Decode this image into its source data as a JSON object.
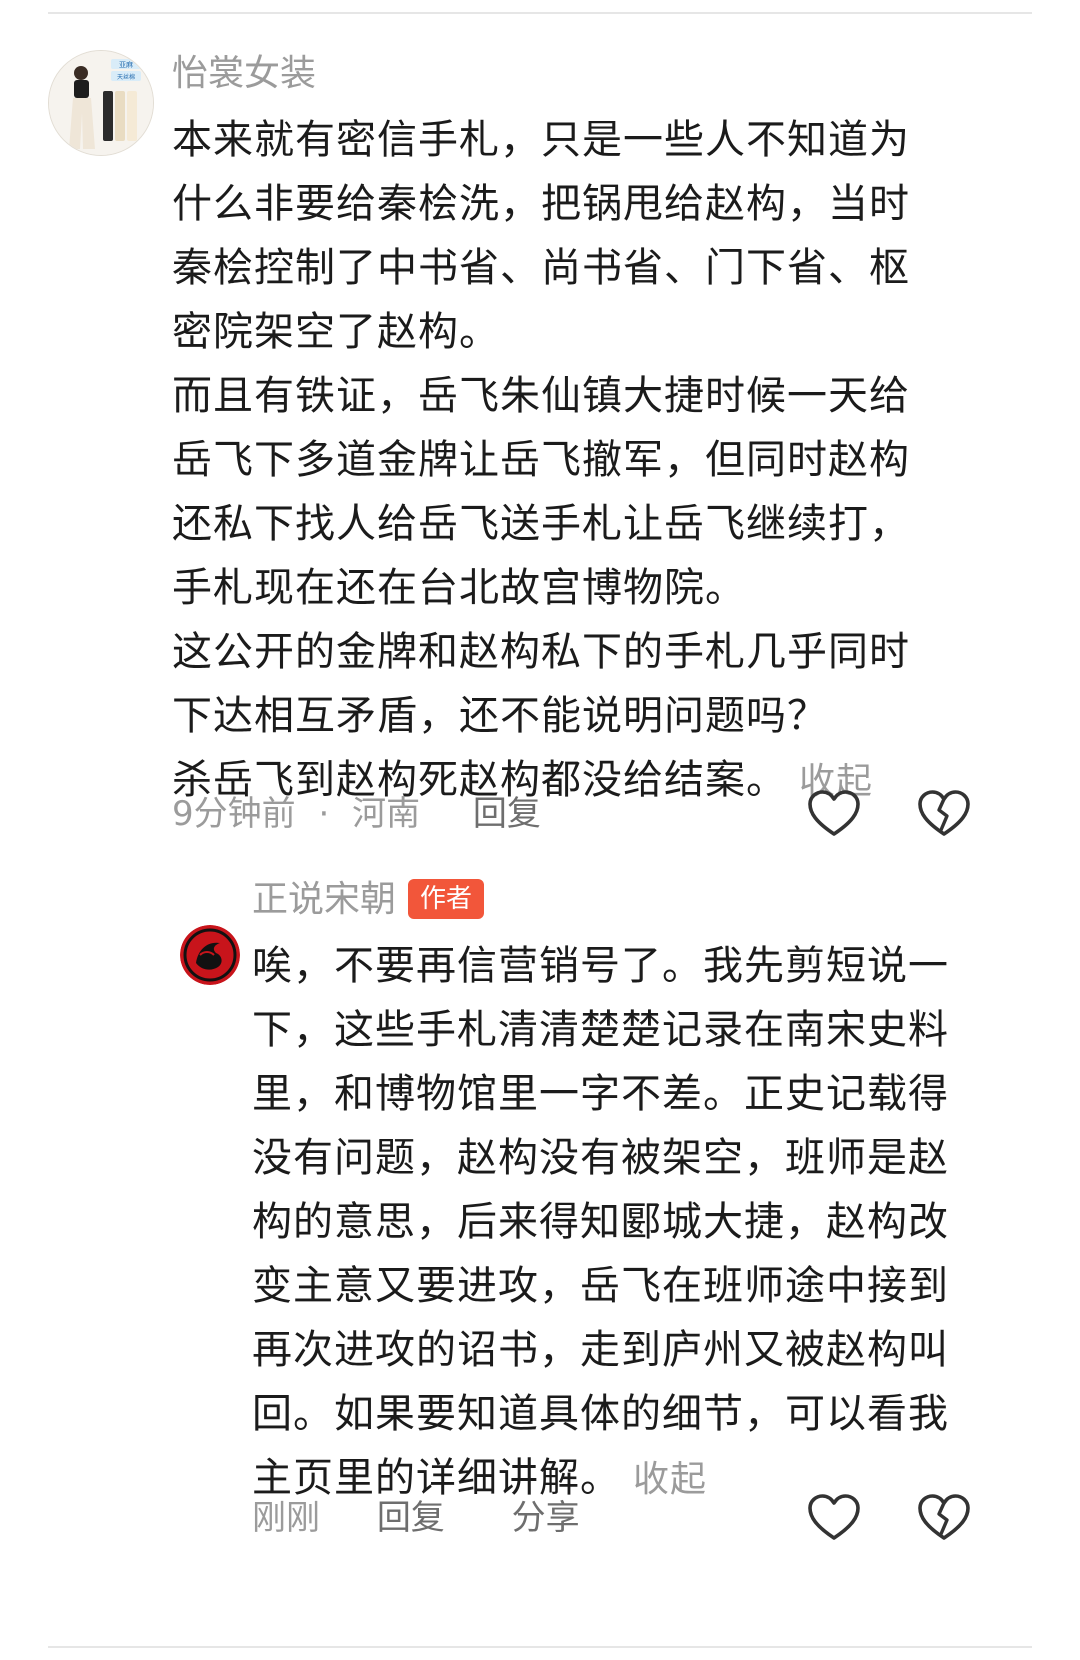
{
  "comment": {
    "username": "怡裳女装",
    "avatar_text": [
      "亚麻",
      "天丝棉"
    ],
    "paragraphs": [
      "本来就有密信手札，只是一些人不知道为什么非要给秦桧洗，把锅甩给赵构，当时秦桧控制了中书省、尚书省、门下省、枢密院架空了赵构。",
      "而且有铁证，岳飞朱仙镇大捷时候一天给岳飞下多道金牌让岳飞撤军，但同时赵构还私下找人给岳飞送手札让岳飞继续打，手札现在还在台北故宫博物院。",
      "这公开的金牌和赵构私下的手札几乎同时下达相互矛盾，还不能说明问题吗？",
      "杀岳飞到赵构死赵构都没给结案。"
    ],
    "collapse_label": "收起",
    "time": "9分钟前",
    "separator": "·",
    "location": "河南",
    "reply_label": "回复"
  },
  "reply": {
    "username": "正说宋朝",
    "badge": "作者",
    "badge_color": "#f2563a",
    "paragraphs": [
      "唉，不要再信营销号了。我先剪短说一下，这些手札清清楚楚记录在南宋史料里，和博物馆里一字不差。正史记载得没有问题，赵构没有被架空，班师是赵构的意思，后来得知郾城大捷，赵构改变主意又要进攻，岳飞在班师途中接到再次进攻的诏书，走到庐州又被赵构叫回。如果要知道具体的细节，可以看我主页里的详细讲解。"
    ],
    "collapse_label": "收起",
    "time": "刚刚",
    "reply_label": "回复",
    "share_label": "分享"
  },
  "icons": {
    "like": "heart-outline-icon",
    "dislike": "broken-heart-outline-icon"
  },
  "colors": {
    "text": "#1b1b1b",
    "muted": "#9b9b9b",
    "badge": "#f2563a",
    "author_avatar": "#c8141b"
  }
}
